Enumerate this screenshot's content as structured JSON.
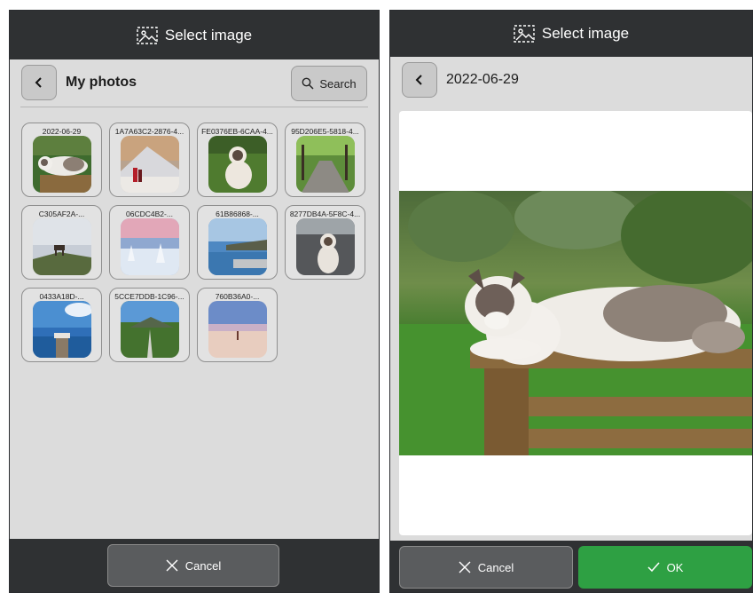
{
  "left_panel": {
    "title": "Select image",
    "title_icon": "image-select-icon",
    "header": "My photos",
    "search_label": "Search",
    "tiles": [
      {
        "label": "2022-06-29",
        "scene": "cat-on-fence"
      },
      {
        "label": "1A7A63C2-2876-4...",
        "scene": "mountain-snow"
      },
      {
        "label": "FE0376EB-6CAA-4...",
        "scene": "cat-grass"
      },
      {
        "label": "95D206E5-5818-4...",
        "scene": "tree-avenue"
      },
      {
        "label": "C305AF2A-...",
        "scene": "reindeer-hill"
      },
      {
        "label": "06CDC4B2-...",
        "scene": "snowy-forest-sunset"
      },
      {
        "label": "61B86868-...",
        "scene": "lake-island"
      },
      {
        "label": "8277DB4A-5F8C-4...",
        "scene": "cat-in-car"
      },
      {
        "label": "0433A18D-...",
        "scene": "pier"
      },
      {
        "label": "5CCE7DDB-1C96-...",
        "scene": "moor-mountain"
      },
      {
        "label": "760B36A0-...",
        "scene": "snow-field-dusk"
      }
    ],
    "cancel_label": "Cancel"
  },
  "right_panel": {
    "title": "Select image",
    "header": "2022-06-29",
    "cancel_label": "Cancel",
    "ok_label": "OK"
  },
  "colors": {
    "titlebar": "#2f3133",
    "panel_bg": "#dcdcdc",
    "ok_green": "#2ea043",
    "cancel_gray": "#5a5c5e"
  }
}
